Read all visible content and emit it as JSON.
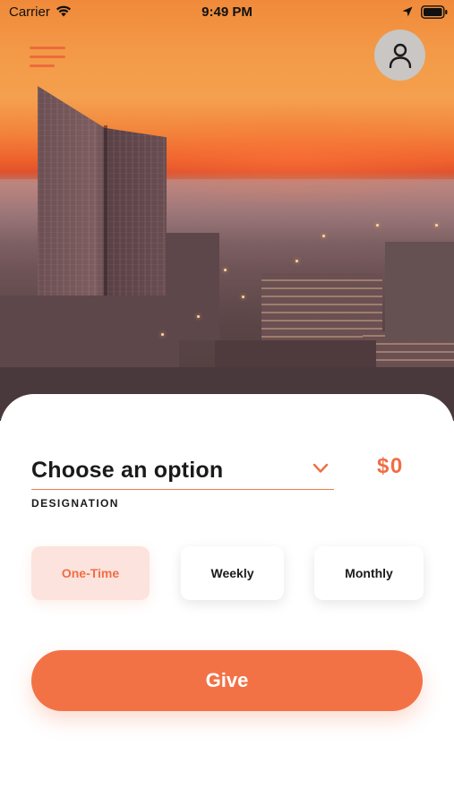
{
  "status_bar": {
    "carrier": "Carrier",
    "time": "9:49 PM",
    "icons": [
      "wifi-icon",
      "location-arrow-icon",
      "battery-icon"
    ]
  },
  "header": {
    "menu_icon": "hamburger-menu-icon",
    "profile_icon": "user-profile-icon"
  },
  "donation_form": {
    "designation": {
      "selected_value": "Choose an option",
      "label": "DESIGNATION",
      "icon": "chevron-down-icon"
    },
    "amount": "$0",
    "frequency_options": [
      {
        "label": "One-Time",
        "selected": true
      },
      {
        "label": "Weekly",
        "selected": false
      },
      {
        "label": "Monthly",
        "selected": false
      }
    ],
    "submit_label": "Give"
  },
  "colors": {
    "accent": "#f27246",
    "accent_light": "#fde3dd",
    "text": "#1a1a1a",
    "profile_bg": "#c9c6c4"
  }
}
